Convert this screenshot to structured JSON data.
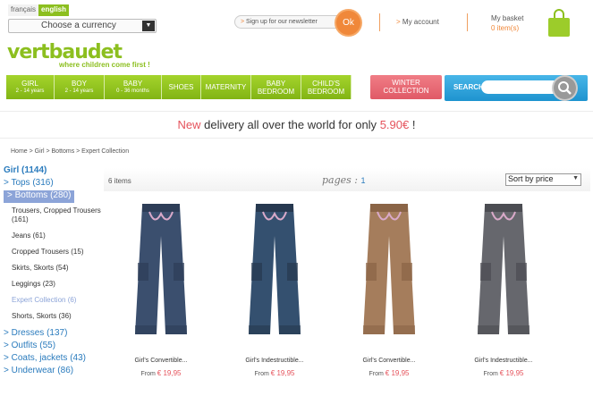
{
  "header": {
    "lang_fr": "français",
    "lang_en": "english",
    "currency_placeholder": "Choose a currency",
    "newsletter": "Sign up for our newsletter",
    "ok": "Ok",
    "account": "My account",
    "basket_title": "My basket",
    "basket_count": "0 item(s)",
    "logo": "vertbaudet",
    "tagline": "where children come first !"
  },
  "nav": [
    {
      "label": "GIRL",
      "sub": "2 - 14 years"
    },
    {
      "label": "BOY",
      "sub": "2 - 14 years"
    },
    {
      "label": "BABY",
      "sub": "0 - 36 months"
    },
    {
      "label": "SHOES",
      "sub": ""
    },
    {
      "label": "MATERNITY",
      "sub": ""
    },
    {
      "label": "BABY",
      "sub": "BEDROOM"
    },
    {
      "label": "CHILD'S",
      "sub": "BEDROOM"
    }
  ],
  "winter": {
    "line1": "WINTER",
    "line2": "COLLECTION"
  },
  "search": {
    "label": "SEARCH"
  },
  "promo": {
    "new": "New",
    "text": " delivery all over the world for only ",
    "price": "5.90€",
    "end": " !"
  },
  "breadcrumb": "Home > Girl > Bottoms > Expert Collection",
  "sidebar": {
    "top": "Girl (1144)",
    "tops": "> Tops (316)",
    "bottoms": "> Bottoms (280)",
    "subs": [
      "Trousers, Cropped Trousers (161)",
      "Jeans (61)",
      "Cropped Trousers (15)",
      "Skirts, Skorts (54)",
      "Leggings (23)",
      "Expert Collection (6)",
      "Shorts, Skorts (36)"
    ],
    "more": [
      "> Dresses (137)",
      "> Outfits (55)",
      "> Coats, jackets (43)",
      "> Underwear (86)"
    ]
  },
  "listing": {
    "items": "6 items",
    "pages_label": "pages :",
    "page_num": "1",
    "sort": "Sort by price"
  },
  "products": [
    {
      "name": "Girl's Convertible...",
      "from": "From",
      "price": "€ 19,95",
      "color": "#3b4f6e",
      "accent": "#2d3d57"
    },
    {
      "name": "Girl's Indestructible...",
      "from": "From",
      "price": "€ 19,95",
      "color": "#34506f",
      "accent": "#26384f"
    },
    {
      "name": "Girl's Convertible...",
      "from": "From",
      "price": "€ 19,95",
      "color": "#a57d5c",
      "accent": "#8a6446"
    },
    {
      "name": "Girl's Indestructible...",
      "from": "From",
      "price": "€ 19,95",
      "color": "#66676d",
      "accent": "#4b4c52"
    }
  ]
}
